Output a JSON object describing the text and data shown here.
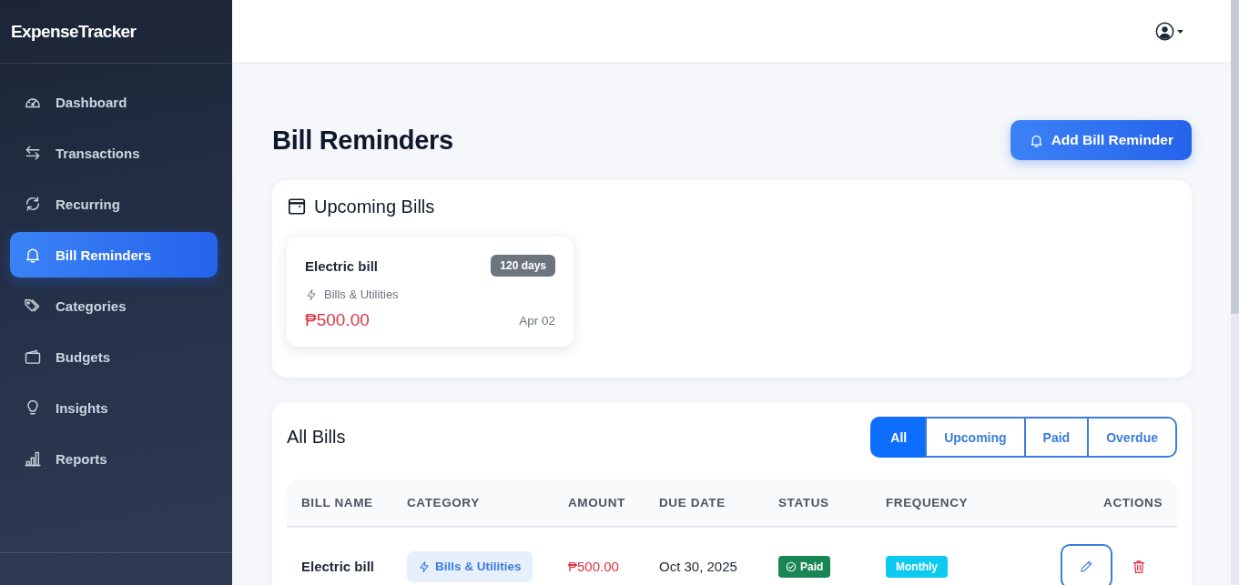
{
  "sidebar": {
    "logo": "ExpenseTracker",
    "items": [
      {
        "label": "Dashboard",
        "selected": false
      },
      {
        "label": "Transactions",
        "selected": false
      },
      {
        "label": "Recurring",
        "selected": false
      },
      {
        "label": "Bill Reminders",
        "selected": true
      },
      {
        "label": "Categories",
        "selected": false
      },
      {
        "label": "Budgets",
        "selected": false
      },
      {
        "label": "Insights",
        "selected": false
      },
      {
        "label": "Reports",
        "selected": false
      }
    ]
  },
  "page_header": {
    "title": "Bill Reminders",
    "add_button": "Add Bill Reminder"
  },
  "upcoming_bills": {
    "title": "Upcoming Bills",
    "bills": [
      {
        "name": "Electric bill",
        "badge": "120 days",
        "category": "Bills & Utilities",
        "amount": "₱500.00",
        "date": "Apr 02"
      }
    ]
  },
  "all_bills": {
    "title": "All Bills",
    "filters": [
      {
        "label": "All",
        "selected": true
      },
      {
        "label": "Upcoming",
        "selected": false
      },
      {
        "label": "Paid",
        "selected": false
      },
      {
        "label": "Overdue",
        "selected": false
      }
    ],
    "table": {
      "columns": [
        "BILL NAME",
        "CATEGORY",
        "AMOUNT",
        "DUE DATE",
        "STATUS",
        "FREQUENCY",
        "ACTIONS"
      ],
      "rows": [
        {
          "bill_name": "Electric bill",
          "category": "Bills & Utilities",
          "amount": "₱500.00",
          "due_date": "Oct 30, 2025",
          "status": "Paid",
          "frequency": "Monthly"
        }
      ]
    }
  }
}
